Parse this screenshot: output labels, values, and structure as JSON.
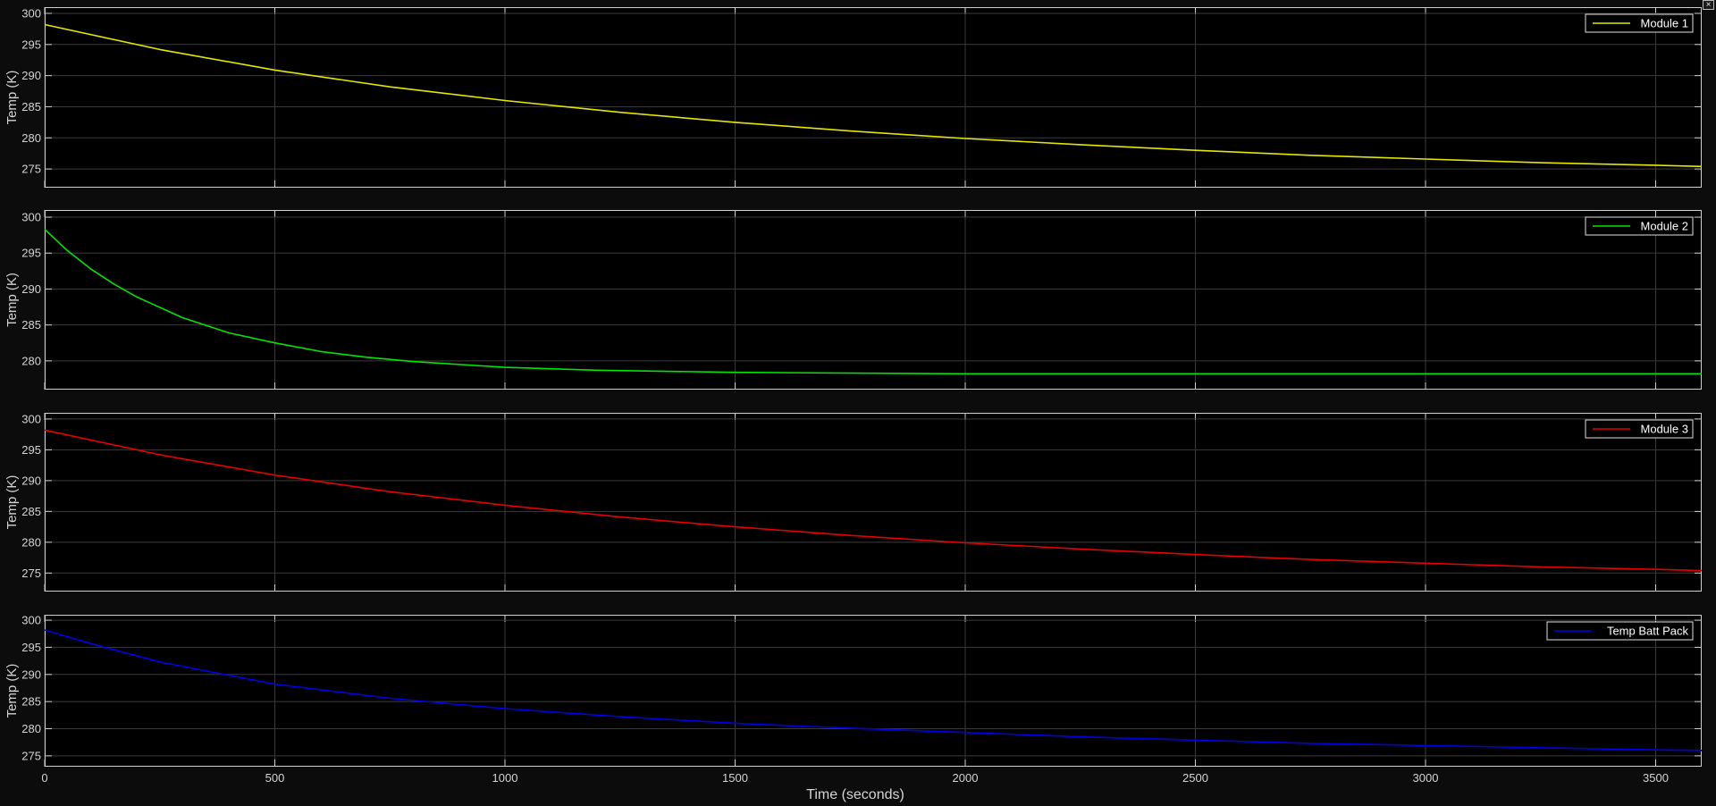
{
  "chart_data": [
    {
      "type": "line",
      "ylabel": "Temp (K)",
      "xlim": [
        0,
        3600
      ],
      "ylim": [
        272,
        301
      ],
      "x_ticks": [
        0,
        500,
        1000,
        1500,
        2000,
        2500,
        3000,
        3500
      ],
      "y_ticks": [
        275,
        280,
        285,
        290,
        295,
        300
      ],
      "grid": true,
      "legend": "top-right",
      "series": [
        {
          "name": "Module 1",
          "color": "#e6e600",
          "x": [
            0,
            250,
            500,
            750,
            1000,
            1250,
            1500,
            1750,
            2000,
            2250,
            2500,
            2750,
            3000,
            3250,
            3500,
            3600
          ],
          "values": [
            298.2,
            294.2,
            290.9,
            288.2,
            286.0,
            284.1,
            282.5,
            281.1,
            279.9,
            278.9,
            278.0,
            277.2,
            276.6,
            276.0,
            275.6,
            275.4
          ]
        }
      ]
    },
    {
      "type": "line",
      "ylabel": "Temp (K)",
      "xlim": [
        0,
        3600
      ],
      "ylim": [
        276,
        301
      ],
      "x_ticks": [
        0,
        500,
        1000,
        1500,
        2000,
        2500,
        3000,
        3500
      ],
      "y_ticks": [
        280,
        285,
        290,
        295,
        300
      ],
      "grid": true,
      "legend": "top-right",
      "series": [
        {
          "name": "Module 2",
          "color": "#00e600",
          "x": [
            0,
            50,
            100,
            150,
            200,
            300,
            400,
            500,
            600,
            700,
            800,
            1000,
            1200,
            1500,
            2000,
            2500,
            3000,
            3600
          ],
          "values": [
            298.3,
            295.3,
            292.8,
            290.7,
            288.9,
            286.0,
            283.9,
            282.5,
            281.3,
            280.5,
            279.9,
            279.1,
            278.7,
            278.4,
            278.2,
            278.2,
            278.2,
            278.2
          ]
        }
      ]
    },
    {
      "type": "line",
      "ylabel": "Temp (K)",
      "xlim": [
        0,
        3600
      ],
      "ylim": [
        272,
        301
      ],
      "x_ticks": [
        0,
        500,
        1000,
        1500,
        2000,
        2500,
        3000,
        3500
      ],
      "y_ticks": [
        275,
        280,
        285,
        290,
        295,
        300
      ],
      "grid": true,
      "legend": "top-right",
      "series": [
        {
          "name": "Module 3",
          "color": "#e60000",
          "x": [
            0,
            250,
            500,
            750,
            1000,
            1250,
            1500,
            1750,
            2000,
            2250,
            2500,
            2750,
            3000,
            3250,
            3500,
            3600
          ],
          "values": [
            298.2,
            294.2,
            290.9,
            288.2,
            286.0,
            284.1,
            282.5,
            281.1,
            279.9,
            278.9,
            278.0,
            277.2,
            276.6,
            276.0,
            275.6,
            275.4
          ]
        }
      ]
    },
    {
      "type": "line",
      "ylabel": "Temp (K)",
      "xlabel": "Time (seconds)",
      "xlim": [
        0,
        3600
      ],
      "ylim": [
        273,
        301
      ],
      "x_ticks": [
        0,
        500,
        1000,
        1500,
        2000,
        2500,
        3000,
        3500
      ],
      "y_ticks": [
        275,
        280,
        285,
        290,
        295,
        300
      ],
      "grid": true,
      "legend": "top-right",
      "series": [
        {
          "name": "Temp Batt Pack",
          "color": "#0000e6",
          "x": [
            0,
            100,
            250,
            500,
            750,
            1000,
            1250,
            1500,
            1750,
            2000,
            2250,
            2500,
            2750,
            3000,
            3250,
            3500,
            3600
          ],
          "values": [
            298.2,
            295.7,
            292.3,
            288.2,
            285.6,
            283.7,
            282.2,
            281.0,
            280.1,
            279.3,
            278.5,
            277.9,
            277.3,
            276.9,
            276.5,
            276.1,
            276.0
          ]
        }
      ]
    }
  ]
}
